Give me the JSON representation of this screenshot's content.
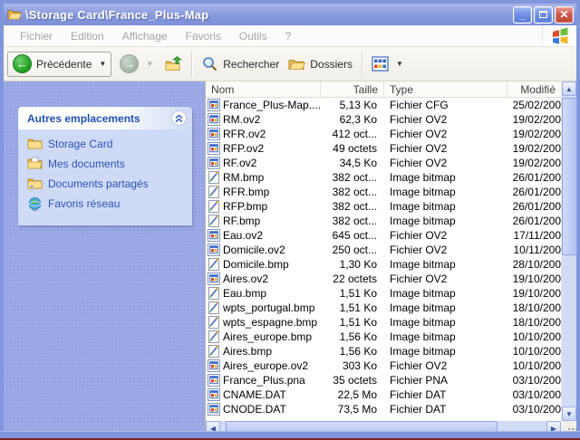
{
  "window": {
    "title": "\\Storage Card\\France_Plus-Map",
    "controls": {
      "minimize": "minimize",
      "maximize": "maximize",
      "close": "close"
    }
  },
  "menu": {
    "items": [
      "Fichier",
      "Edition",
      "Affichage",
      "Favoris",
      "Outils",
      "?"
    ]
  },
  "toolbar": {
    "back_label": "Précédente",
    "search_label": "Rechercher",
    "folders_label": "Dossiers",
    "icons": [
      "back-icon",
      "forward-icon",
      "up-folder-icon",
      "search-icon",
      "folders-icon",
      "views-icon"
    ]
  },
  "sidebar": {
    "panel_title": "Autres emplacements",
    "items": [
      {
        "label": "Storage Card",
        "icon": "folder-icon"
      },
      {
        "label": "Mes documents",
        "icon": "my-documents-icon"
      },
      {
        "label": "Documents partagés",
        "icon": "shared-folder-icon"
      },
      {
        "label": "Favoris réseau",
        "icon": "network-icon"
      }
    ]
  },
  "list": {
    "columns": [
      "Nom",
      "Taille",
      "Type",
      "Modifié"
    ],
    "rows": [
      {
        "name": "France_Plus-Map....",
        "size": "5,13 Ko",
        "type": "Fichier CFG",
        "date": "25/02/200",
        "icon": "generic-file-icon"
      },
      {
        "name": "RM.ov2",
        "size": "62,3 Ko",
        "type": "Fichier OV2",
        "date": "19/02/200",
        "icon": "generic-file-icon"
      },
      {
        "name": "RFR.ov2",
        "size": "412 oct...",
        "type": "Fichier OV2",
        "date": "19/02/200",
        "icon": "generic-file-icon"
      },
      {
        "name": "RFP.ov2",
        "size": "49 octets",
        "type": "Fichier OV2",
        "date": "19/02/200",
        "icon": "generic-file-icon"
      },
      {
        "name": "RF.ov2",
        "size": "34,5 Ko",
        "type": "Fichier OV2",
        "date": "19/02/200",
        "icon": "generic-file-icon"
      },
      {
        "name": "RM.bmp",
        "size": "382 oct...",
        "type": "Image bitmap",
        "date": "26/01/200",
        "icon": "bitmap-image-icon"
      },
      {
        "name": "RFR.bmp",
        "size": "382 oct...",
        "type": "Image bitmap",
        "date": "26/01/200",
        "icon": "bitmap-image-icon"
      },
      {
        "name": "RFP.bmp",
        "size": "382 oct...",
        "type": "Image bitmap",
        "date": "26/01/200",
        "icon": "bitmap-image-icon"
      },
      {
        "name": "RF.bmp",
        "size": "382 oct...",
        "type": "Image bitmap",
        "date": "26/01/200",
        "icon": "bitmap-image-icon"
      },
      {
        "name": "Eau.ov2",
        "size": "645 oct...",
        "type": "Fichier OV2",
        "date": "17/11/200",
        "icon": "generic-file-icon"
      },
      {
        "name": "Domicile.ov2",
        "size": "250 oct...",
        "type": "Fichier OV2",
        "date": "10/11/200",
        "icon": "generic-file-icon"
      },
      {
        "name": "Domicile.bmp",
        "size": "1,30 Ko",
        "type": "Image bitmap",
        "date": "28/10/200",
        "icon": "bitmap-image-icon"
      },
      {
        "name": "Aires.ov2",
        "size": "22 octets",
        "type": "Fichier OV2",
        "date": "19/10/200",
        "icon": "generic-file-icon"
      },
      {
        "name": "Eau.bmp",
        "size": "1,51 Ko",
        "type": "Image bitmap",
        "date": "19/10/200",
        "icon": "bitmap-image-icon"
      },
      {
        "name": "wpts_portugal.bmp",
        "size": "1,51 Ko",
        "type": "Image bitmap",
        "date": "18/10/200",
        "icon": "bitmap-image-icon"
      },
      {
        "name": "wpts_espagne.bmp",
        "size": "1,51 Ko",
        "type": "Image bitmap",
        "date": "18/10/200",
        "icon": "bitmap-image-icon"
      },
      {
        "name": "Aires_europe.bmp",
        "size": "1,56 Ko",
        "type": "Image bitmap",
        "date": "10/10/200",
        "icon": "bitmap-image-icon"
      },
      {
        "name": "Aires.bmp",
        "size": "1,56 Ko",
        "type": "Image bitmap",
        "date": "10/10/200",
        "icon": "bitmap-image-icon"
      },
      {
        "name": "Aires_europe.ov2",
        "size": "303 Ko",
        "type": "Fichier OV2",
        "date": "10/10/200",
        "icon": "generic-file-icon"
      },
      {
        "name": "France_Plus.pna",
        "size": "35 octets",
        "type": "Fichier PNA",
        "date": "03/10/200",
        "icon": "generic-file-icon"
      },
      {
        "name": "CNAME.DAT",
        "size": "22,5 Mo",
        "type": "Fichier DAT",
        "date": "03/10/200",
        "icon": "generic-file-icon"
      },
      {
        "name": "CNODE.DAT",
        "size": "73,5 Mo",
        "type": "Fichier DAT",
        "date": "03/10/200",
        "icon": "generic-file-icon"
      }
    ]
  },
  "colors": {
    "titlebar_blue": "#8597DC",
    "sidebar_blue": "#97A5E3",
    "panel_body_blue": "#CFDAF6",
    "panel_text_blue": "#1E50B4",
    "close_red": "#BC4434",
    "scrollbar_track": "#CDD8F4",
    "bottom_edge_red": "#802626"
  }
}
